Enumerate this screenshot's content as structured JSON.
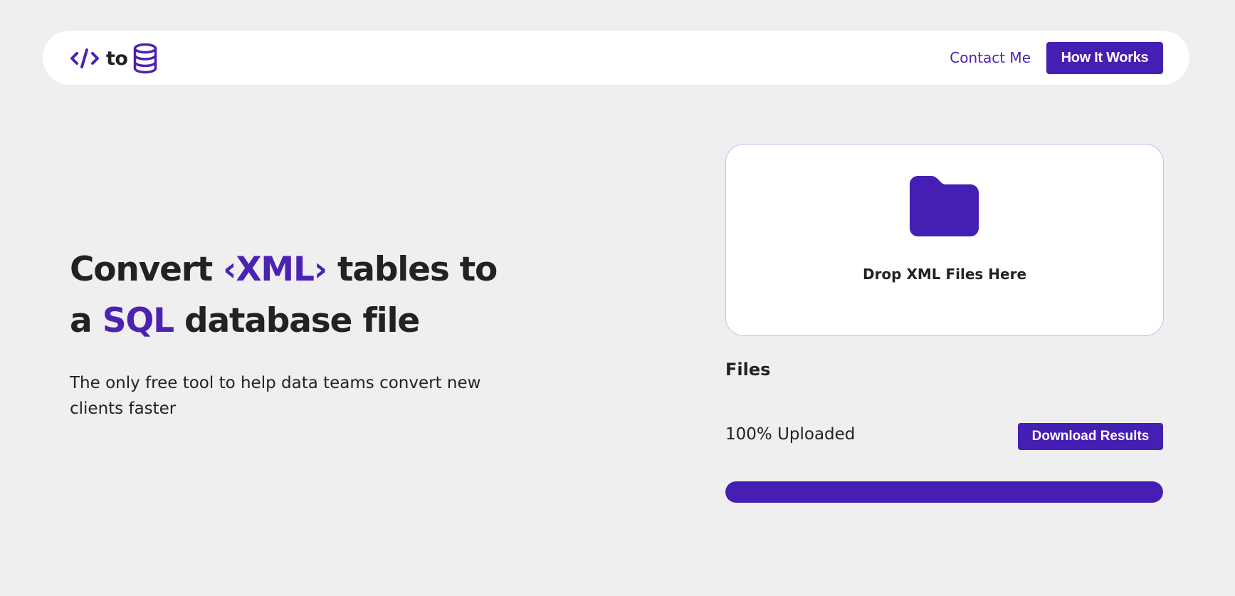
{
  "header": {
    "logo": {
      "code_icon": "code-brackets-icon",
      "text": "to",
      "db_icon": "database-icon"
    },
    "nav": {
      "contact_label": "Contact Me",
      "how_label": "How It Works"
    }
  },
  "hero": {
    "title_line1_prefix": "Convert ",
    "title_line1_accent": "‹XML›",
    "title_line1_suffix": " tables to",
    "title_line2_prefix": "a ",
    "title_line2_accent": "SQL",
    "title_line2_suffix": " database file",
    "subtitle": "The only free tool to help data teams convert new clients faster"
  },
  "upload": {
    "folder_icon": "folder-icon",
    "drop_label": "Drop XML Files Here",
    "files_heading": "Files",
    "status_text": "100% Uploaded",
    "download_label": "Download Results",
    "progress": 1.0
  },
  "colors": {
    "accent": "#451eb3",
    "background": "#efefef",
    "text": "#222222",
    "surface": "#ffffff"
  }
}
